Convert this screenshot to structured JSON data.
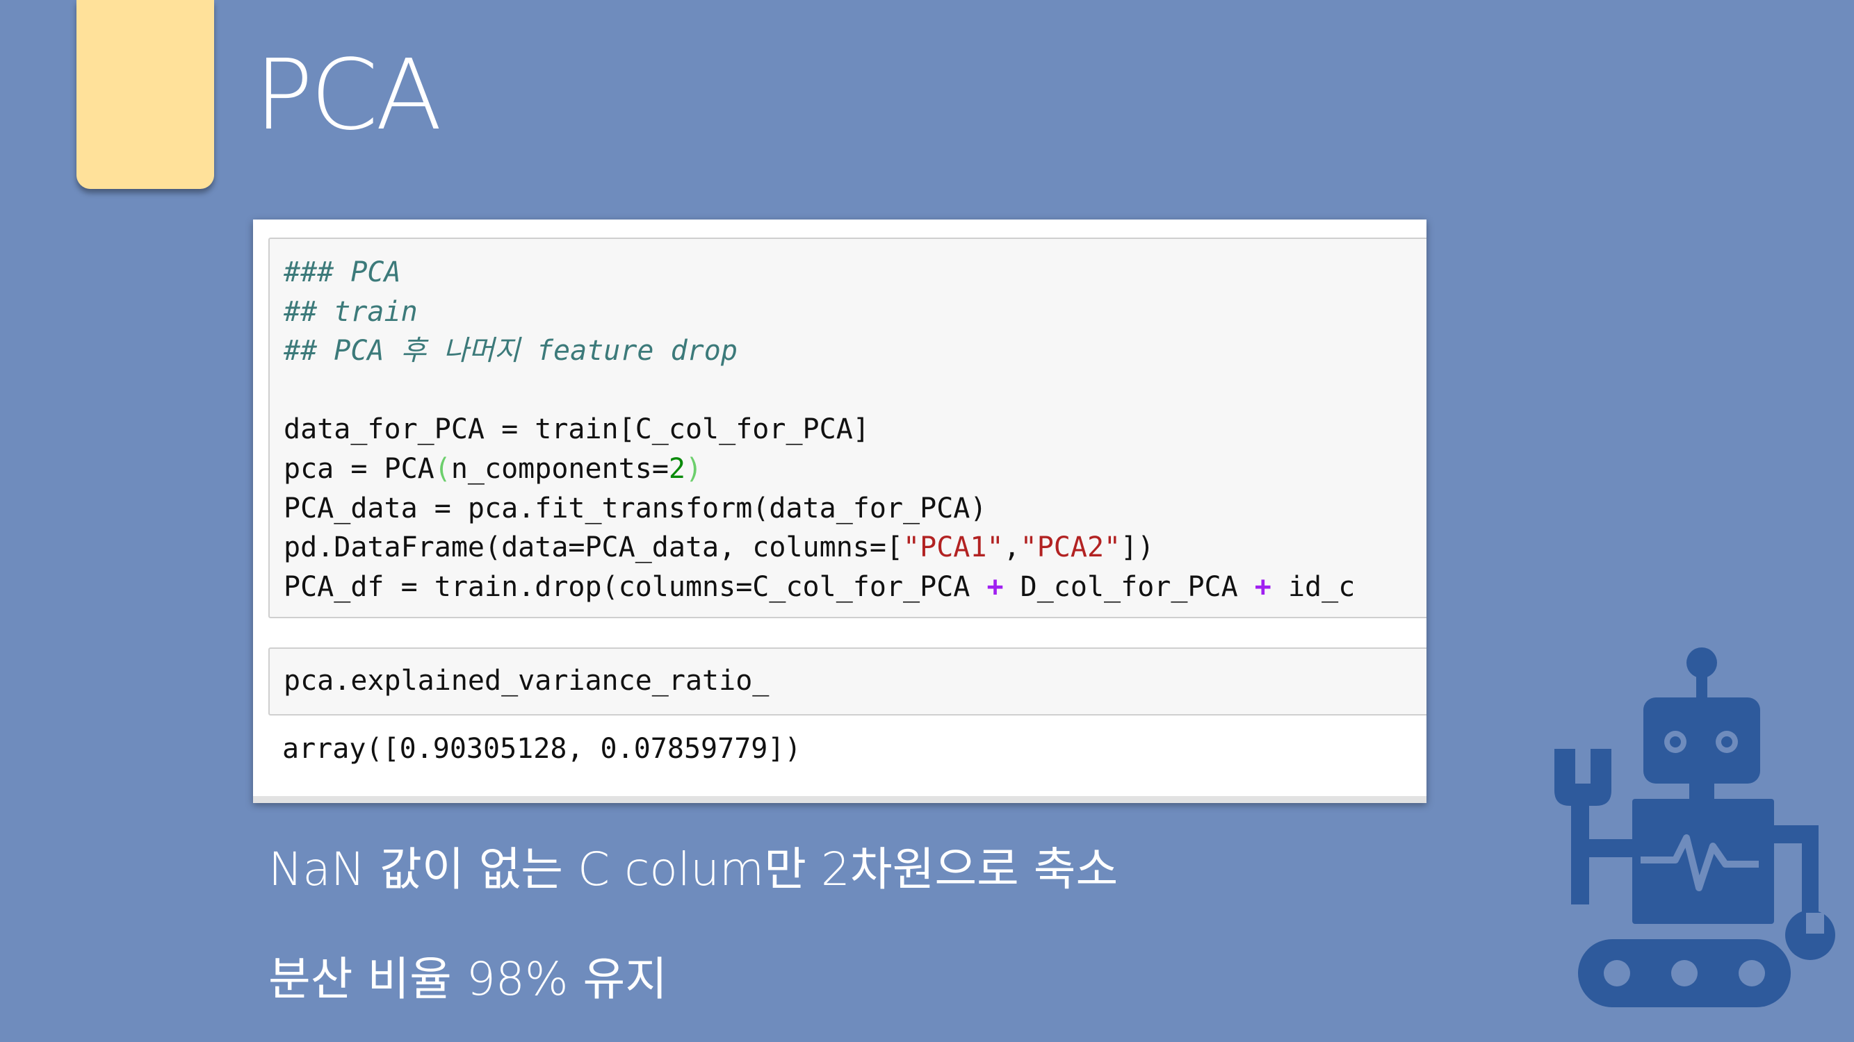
{
  "slide": {
    "title": "PCA",
    "colors": {
      "background": "#6f8cbd",
      "tab": "#ffe19a",
      "robot": "#2e5a9c"
    }
  },
  "notebook": {
    "cell1_lines": [
      {
        "parts": [
          {
            "t": "### PCA",
            "c": "cmt"
          }
        ]
      },
      {
        "parts": [
          {
            "t": "## train",
            "c": "cmt"
          }
        ]
      },
      {
        "parts": [
          {
            "t": "## PCA 후 나머지 feature drop",
            "c": "cmt"
          }
        ]
      },
      {
        "parts": [
          {
            "t": "",
            "c": ""
          }
        ]
      },
      {
        "parts": [
          {
            "t": "data_for_PCA = train[C_col_for_PCA]",
            "c": ""
          }
        ]
      },
      {
        "parts": [
          {
            "t": "pca = PCA",
            "c": ""
          },
          {
            "t": "(",
            "c": "par"
          },
          {
            "t": "n_components=",
            "c": ""
          },
          {
            "t": "2",
            "c": "num"
          },
          {
            "t": ")",
            "c": "par"
          }
        ]
      },
      {
        "parts": [
          {
            "t": "PCA_data = pca.fit_transform(data_for_PCA)",
            "c": ""
          }
        ]
      },
      {
        "parts": [
          {
            "t": "pd.DataFrame(data=PCA_data, columns=[",
            "c": ""
          },
          {
            "t": "\"PCA1\"",
            "c": "str"
          },
          {
            "t": ",",
            "c": ""
          },
          {
            "t": "\"PCA2\"",
            "c": "str"
          },
          {
            "t": "])",
            "c": ""
          }
        ]
      },
      {
        "parts": [
          {
            "t": "PCA_df = train.drop(columns=C_col_for_PCA ",
            "c": ""
          },
          {
            "t": "+",
            "c": "op"
          },
          {
            "t": " D_col_for_PCA ",
            "c": ""
          },
          {
            "t": "+",
            "c": "op"
          },
          {
            "t": " id_c",
            "c": ""
          }
        ]
      }
    ],
    "cell2_code": "pca.explained_variance_ratio_",
    "cell2_output": "array([0.90305128, 0.07859779])"
  },
  "notes": {
    "line1": "NaN 값이 없는 C colum만 2차원으로 축소",
    "line2": "분산 비율 98% 유지"
  },
  "icons": {
    "decoration": "robot-icon"
  }
}
